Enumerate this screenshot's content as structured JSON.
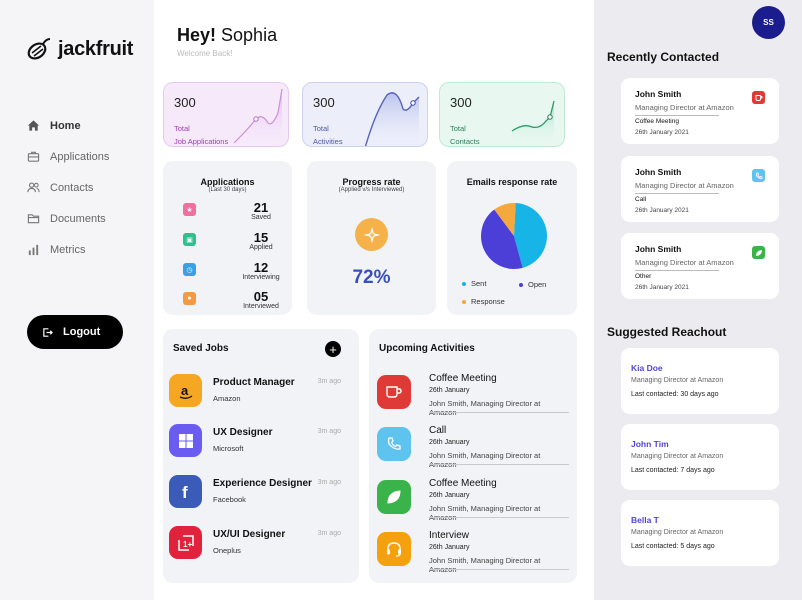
{
  "brand": {
    "name": "jackfruit"
  },
  "nav": {
    "items": [
      {
        "label": "Home",
        "icon": "home-icon"
      },
      {
        "label": "Applications",
        "icon": "briefcase-icon"
      },
      {
        "label": "Contacts",
        "icon": "users-icon"
      },
      {
        "label": "Documents",
        "icon": "folder-icon"
      },
      {
        "label": "Metrics",
        "icon": "bar-chart-icon"
      }
    ],
    "active": "Home",
    "logout_label": "Logout"
  },
  "header": {
    "greeting_prefix": "Hey!",
    "user_name": "Sophia",
    "subtitle": "Welcome Back!"
  },
  "avatar": {
    "initials": "SS"
  },
  "stats": [
    {
      "value": "300",
      "label_line1": "Total",
      "label_line2": "Job Applications",
      "color": "#9c3fb4"
    },
    {
      "value": "300",
      "label_line1": "Total",
      "label_line2": "Activities",
      "color": "#4c5aa8"
    },
    {
      "value": "300",
      "label_line1": "Total",
      "label_line2": "Contacts",
      "color": "#2a7d5a"
    }
  ],
  "applications": {
    "title": "Applications",
    "subtitle": "(Last 30 days)",
    "rows": [
      {
        "value": "21",
        "label": "Saved",
        "color": "#ef6fa0",
        "icon": "star-icon"
      },
      {
        "value": "15",
        "label": "Applied",
        "color": "#2fc08e",
        "icon": "briefcase-icon"
      },
      {
        "value": "12",
        "label": "Interviewing",
        "color": "#3aa0e8",
        "icon": "clock-icon"
      },
      {
        "value": "05",
        "label": "Interviewed",
        "color": "#f59a42",
        "icon": "people-icon"
      }
    ]
  },
  "progress": {
    "title": "Progress rate",
    "subtitle": "(Applied v/s Interviewed)",
    "value": "72%",
    "icon": "sparkle-icon"
  },
  "emails": {
    "title": "Emails response rate",
    "legend": [
      {
        "label": "Sent",
        "color": "#17b4e8"
      },
      {
        "label": "Open",
        "color": "#4b3fd8"
      },
      {
        "label": "Response",
        "color": "#f3a93d"
      }
    ]
  },
  "chart_data": {
    "type": "pie",
    "title": "Emails response rate",
    "categories": [
      "Sent",
      "Open",
      "Response"
    ],
    "values": [
      45,
      44,
      11
    ],
    "colors": [
      "#17b4e8",
      "#4b3fd8",
      "#f3a93d"
    ]
  },
  "saved_jobs": {
    "title": "Saved Jobs",
    "items": [
      {
        "title": "Product Manager",
        "company": "Amazon",
        "ago": "3m ago",
        "color": "#f5a623",
        "icon": "amazon-icon"
      },
      {
        "title": "UX Designer",
        "company": "Microsoft",
        "ago": "3m ago",
        "color": "#6a5cf0",
        "icon": "windows-icon"
      },
      {
        "title": "Experience Designer",
        "company": "Facebook",
        "ago": "3m ago",
        "color": "#3b5bb8",
        "icon": "facebook-icon"
      },
      {
        "title": "UX/UI Designer",
        "company": "Oneplus",
        "ago": "3m ago",
        "color": "#e0223c",
        "icon": "oneplus-icon"
      }
    ]
  },
  "upcoming": {
    "title": "Upcoming Activities",
    "items": [
      {
        "title": "Coffee Meeting",
        "date": "26th January",
        "who": "John Smith, Managing Director at Amazon",
        "color": "#e03a36",
        "icon": "coffee-icon"
      },
      {
        "title": "Call",
        "date": "26th January",
        "who": "John Smith, Managing Director at Amazon",
        "color": "#5ec3ee",
        "icon": "phone-icon"
      },
      {
        "title": "Coffee Meeting",
        "date": "26th January",
        "who": "John Smith, Managing Director at Amazon",
        "color": "#3ab34a",
        "icon": "leaf-icon"
      },
      {
        "title": "Interview",
        "date": "26th January",
        "who": "John Smith, Managing Director at Amazon",
        "color": "#f5a00f",
        "icon": "headset-icon"
      }
    ]
  },
  "recent": {
    "title": "Recently Contacted",
    "items": [
      {
        "name": "John Smith",
        "role": "Managing Director at Amazon",
        "activity": "Coffee Meeting",
        "date": "26th January 2021",
        "color": "#e03a36",
        "icon": "coffee-icon"
      },
      {
        "name": "John Smith",
        "role": "Managing Director at Amazon",
        "activity": "Call",
        "date": "26th January 2021",
        "color": "#5ec3ee",
        "icon": "phone-icon"
      },
      {
        "name": "John Smith",
        "role": "Managing Director at Amazon",
        "activity": "Other",
        "date": "26th January 2021",
        "color": "#3ab34a",
        "icon": "chat-icon"
      }
    ]
  },
  "suggested": {
    "title": "Suggested Reachout",
    "items": [
      {
        "name": "Kia Doe",
        "role": "Managing Director at Amazon",
        "last": "Last contacted: 30 days ago"
      },
      {
        "name": "John Tim",
        "role": "Managing Director at Amazon",
        "last": "Last contacted:  7 days ago"
      },
      {
        "name": "Bella T",
        "role": "Managing Director at Amazon",
        "last": "Last contacted: 5 days ago"
      }
    ]
  }
}
